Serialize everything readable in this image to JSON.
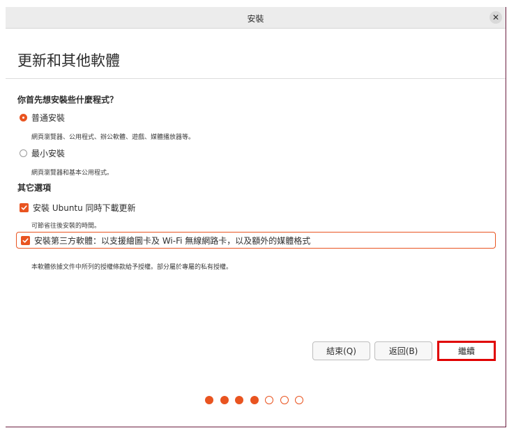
{
  "window": {
    "title": "安裝"
  },
  "page": {
    "title": "更新和其他軟體"
  },
  "install_type": {
    "question": "你首先想安裝些什麼程式？",
    "options": [
      {
        "label": "普通安裝",
        "description": "網頁瀏覽器、公用程式、辦公軟體、遊戲、媒體播放器等。",
        "selected": true
      },
      {
        "label": "最小安裝",
        "description": "網頁瀏覽器和基本公用程式。",
        "selected": false
      }
    ]
  },
  "other_options": {
    "heading": "其它選項",
    "items": [
      {
        "label": "安裝 Ubuntu 同時下載更新",
        "description": "可節省往後安裝的時間。",
        "checked": true
      },
      {
        "label": "安裝第三方軟體：以支援繪圖卡及 Wi-Fi 無線網路卡，以及額外的媒體格式",
        "description": "本軟體依據文件中所列的授權條款給予授權。部分屬於專屬的私有授權。",
        "checked": true
      }
    ]
  },
  "buttons": {
    "quit": "結束(Q)",
    "back": "返回(B)",
    "continue": "繼續"
  },
  "progress": {
    "total_steps": 7,
    "completed_steps": 4
  },
  "colors": {
    "accent": "#e95420",
    "highlight_border": "#e00000"
  }
}
